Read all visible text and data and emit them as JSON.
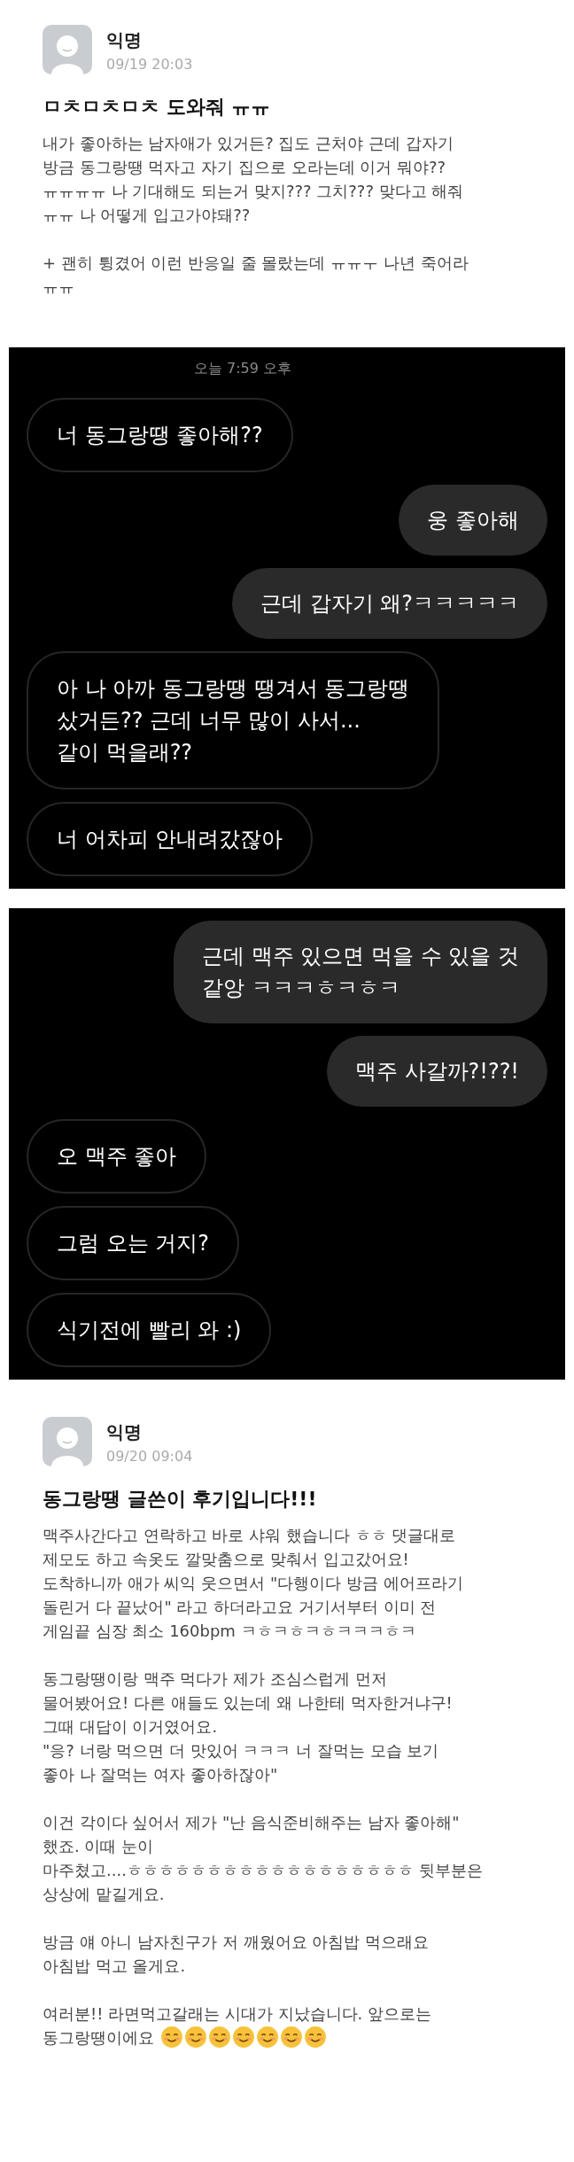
{
  "posts": [
    {
      "author": "익명",
      "date": "09/19 20:03",
      "title": "ㅁㅊㅁㅊㅁㅊ 도와줘 ㅠㅠ",
      "paragraphs": [
        {
          "text": "내가 좋아하는 남자애가 있거든? 집도 근처야 근데 갑자기\n방금 동그랑땡 먹자고 자기 집으로 오라는데 이거 뭐야??\nㅠㅠㅠㅠ 나 기대해도 되는거 맞지??? 그치??? 맞다고 해줘\nㅠㅠ 나 어떻게 입고가야돼??"
        },
        {
          "text": "+ 괜히 튕겼어 이런 반응일 줄 몰랐는데 ㅠㅠㅜ 나년 죽어라\nㅠㅠ"
        }
      ]
    },
    {
      "chat": {
        "timestamp": "오늘 7:59 오후",
        "messages": [
          {
            "kind": "received",
            "text": "너 동그랑땡 좋아해??"
          },
          {
            "kind": "sent",
            "text": "웅 좋아해"
          },
          {
            "kind": "sent",
            "text": "근데 갑자기 왜?ㅋㅋㅋㅋㅋ"
          },
          {
            "kind": "received",
            "text": "아 나 아까 동그랑땡 땡겨서 동그랑땡\n샀거든?? 근데 너무 많이 사서...\n같이 먹을래??"
          },
          {
            "kind": "received",
            "text": "너 어차피 안내려갔잖아"
          }
        ]
      }
    },
    {
      "chat": {
        "messages": [
          {
            "kind": "sent",
            "text": "근데 맥주 있으면 먹을 수 있을 것\n같앙 ㅋㅋㅋㅎㅋㅎㅋ"
          },
          {
            "kind": "sent",
            "text": "맥주 사갈까?!??!"
          },
          {
            "kind": "received",
            "text": "오 맥주 좋아"
          },
          {
            "kind": "received",
            "text": "그럼 오는 거지?"
          },
          {
            "kind": "received",
            "text": "식기전에 빨리 와 :)"
          }
        ]
      }
    },
    {
      "author": "익명",
      "date": "09/20 09:04",
      "title": "동그랑땡 글쓴이 후기입니다!!!",
      "paragraphs": [
        {
          "text": "맥주사간다고 연락하고 바로 샤워 했습니다 ㅎㅎ 댓글대로\n제모도 하고 속옷도 깔맞춤으로 맞춰서 입고갔어요!\n도착하니까 애가 씨익 웃으면서 \"다행이다 방금 에어프라기\n돌린거 다 끝났어\" 라고 하더라고요 거기서부터 이미 전\n게임끝 심장 최소 160bpm ㅋㅎㅋㅎㅋㅎㅋㅋㅋㅎㅋ"
        },
        {
          "text": "동그랑땡이랑 맥주 먹다가 제가 조심스럽게 먼저\n물어봤어요! 다른 애들도 있는데 왜 나한테 먹자한거냐구!\n그때 대답이 이거였어요.\n\"응? 너랑 먹으면 더 맛있어 ㅋㅋㅋ 너 잘먹는 모습 보기\n좋아 나 잘먹는 여자 좋아하잖아\""
        },
        {
          "text": "이건 각이다 싶어서 제가 \"난 음식준비해주는 남자 좋아해\"\n했죠. 이때 눈이\n마주쳤고....ㅎㅎㅎㅎㅎㅎㅎㅎㅎㅎㅎㅎㅎㅎㅎㅎㅎㅎ 뒷부분은\n상상에 맡길게요."
        },
        {
          "text": "방금 얘 아니 남자친구가 저 깨웠어요 아침밥 먹으래요\n아침밥 먹고 올게요."
        },
        {
          "text": "여러분!! 라면먹고갈래는 시대가 지났습니다. 앞으로는\n동그랑땡이에요",
          "icons": [
            {
              "kind": "smile"
            },
            {
              "kind": "smile"
            },
            {
              "kind": "smile"
            },
            {
              "kind": "smile"
            },
            {
              "kind": "smile"
            },
            {
              "kind": "smile"
            },
            {
              "kind": "smile"
            }
          ]
        }
      ]
    }
  ]
}
